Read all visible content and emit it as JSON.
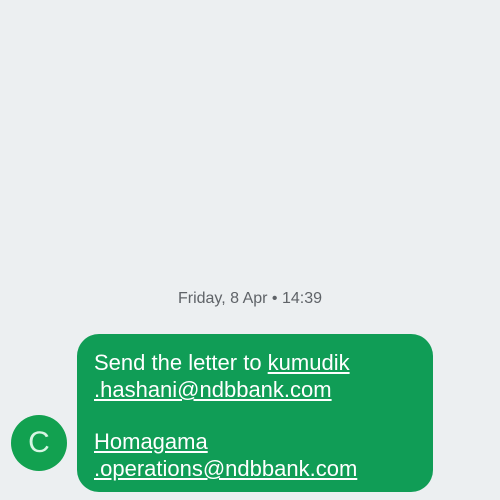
{
  "conversation": {
    "timestamp": "Friday, 8 Apr • 14:39"
  },
  "sender": {
    "avatar_letter": "C"
  },
  "message": {
    "text_prefix": "Send the letter to ",
    "link1_part1": "kumudik",
    "link1_part2": ".hashani@ndbbank.com",
    "link2_part1": "Homagama",
    "link2_part2": ".operations@ndbbank.com"
  },
  "colors": {
    "background": "#eceff1",
    "bubble": "#109d56",
    "avatar": "#12a150"
  }
}
